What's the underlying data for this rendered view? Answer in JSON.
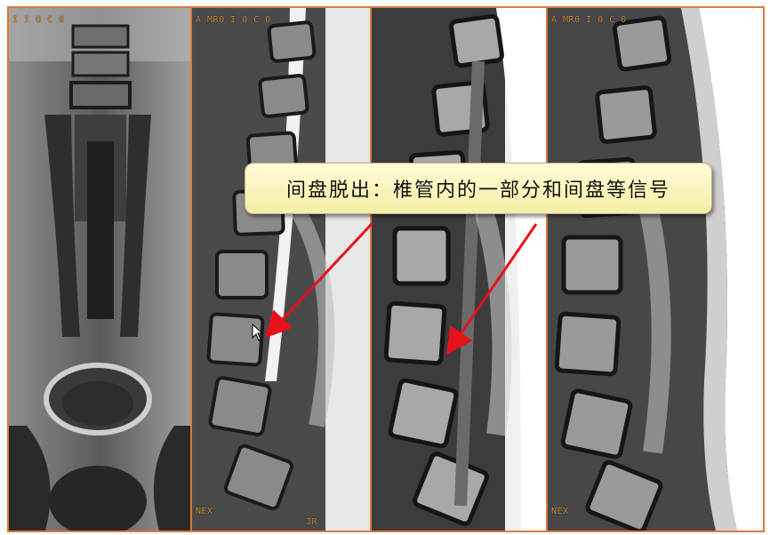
{
  "panels": [
    {
      "label_top": "I I O C 0",
      "label_bottom": ""
    },
    {
      "label_top": "A MR0 I 0 C 0",
      "label_bottom": "NEX",
      "label_bottom_right": "JR"
    },
    {
      "label_top": "",
      "label_bottom": ""
    },
    {
      "label_top": "A MR0 I 0 C 0",
      "label_bottom": "NEX"
    }
  ],
  "callout": {
    "text": "间盘脱出：椎管内的一部分和间盘等信号"
  },
  "colors": {
    "frame_border": "#e07a3c",
    "callout_bg": "#fff8c0",
    "arrow": "#e8101a"
  }
}
